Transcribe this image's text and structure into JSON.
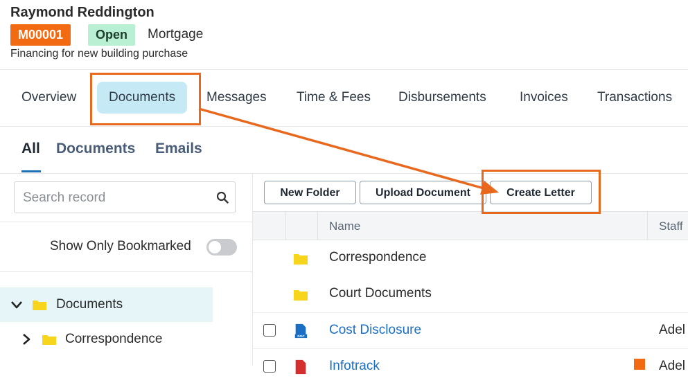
{
  "matter": {
    "client_name": "Raymond Reddington",
    "code": "M00001",
    "status": "Open",
    "type": "Mortgage",
    "description": "Financing for new building purchase"
  },
  "tabs": [
    {
      "label": "Overview"
    },
    {
      "label": "Documents",
      "active": true
    },
    {
      "label": "Messages"
    },
    {
      "label": "Time & Fees"
    },
    {
      "label": "Disbursements"
    },
    {
      "label": "Invoices"
    },
    {
      "label": "Transactions"
    }
  ],
  "subtabs": [
    {
      "label": "All",
      "active": true
    },
    {
      "label": "Documents"
    },
    {
      "label": "Emails"
    }
  ],
  "search": {
    "placeholder": "Search record",
    "icon": "search-icon"
  },
  "bookmark_filter": {
    "label": "Show Only Bookmarked",
    "enabled": false
  },
  "tree": [
    {
      "label": "Documents",
      "expanded": true,
      "selected": true
    },
    {
      "label": "Correspondence",
      "expanded": false
    }
  ],
  "toolbar": {
    "new_folder": "New Folder",
    "upload_document": "Upload Document",
    "create_letter": "Create Letter"
  },
  "grid": {
    "columns": [
      "Name",
      "Staff"
    ],
    "rows": [
      {
        "name": "Correspondence",
        "kind": "folder",
        "staff": ""
      },
      {
        "name": "Court Documents",
        "kind": "folder",
        "staff": ""
      },
      {
        "name": "Cost Disclosure",
        "kind": "doc",
        "staff": "Adel"
      },
      {
        "name": "Infotrack",
        "kind": "pdf",
        "staff": "Adel"
      }
    ]
  },
  "colors": {
    "accent_orange": "#f26b12",
    "status_green": "#b9f0d4",
    "active_tab_bg": "#c6eaf5",
    "link_blue": "#1a6fc4",
    "folder_yellow": "#f7d51d",
    "annotation": "#e8691e"
  }
}
